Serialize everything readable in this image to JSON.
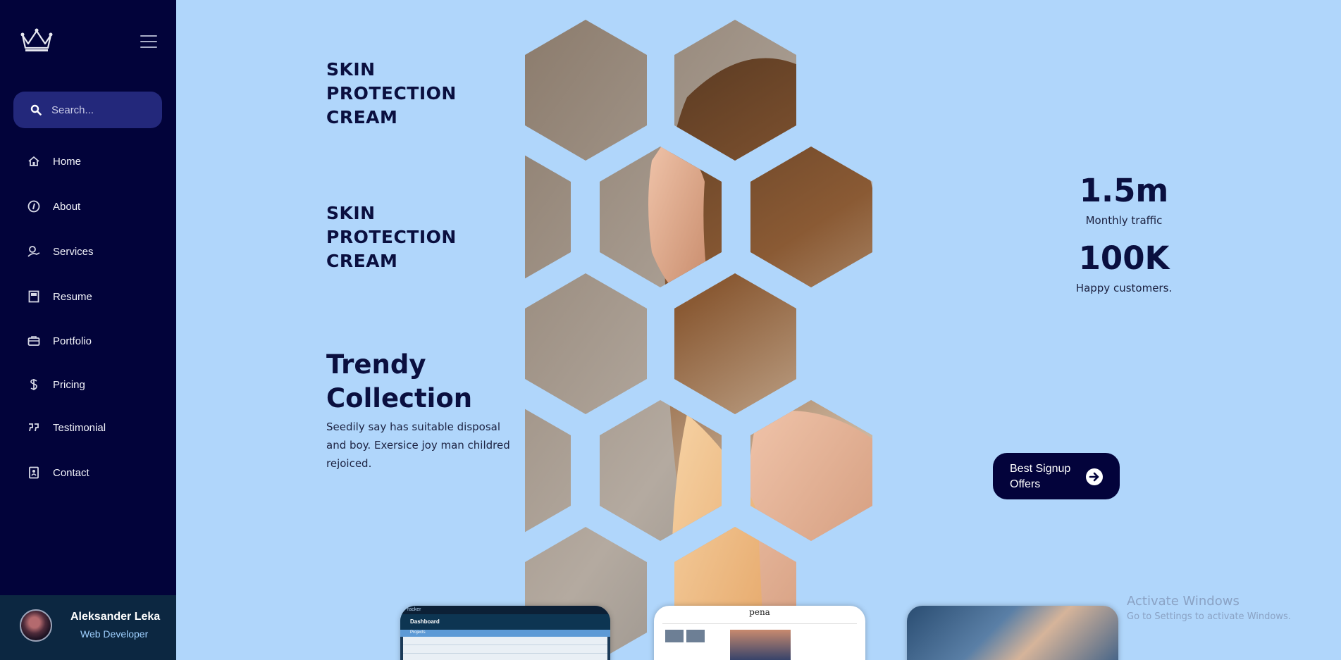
{
  "sidebar": {
    "search_placeholder": "Search...",
    "items": [
      {
        "label": "Home",
        "icon": "home-icon"
      },
      {
        "label": "About",
        "icon": "info-icon"
      },
      {
        "label": "Services",
        "icon": "services-icon"
      },
      {
        "label": "Resume",
        "icon": "resume-icon"
      },
      {
        "label": "Portfolio",
        "icon": "briefcase-icon"
      },
      {
        "label": "Pricing",
        "icon": "dollar-icon"
      },
      {
        "label": "Testimonial",
        "icon": "quote-icon"
      },
      {
        "label": "Contact",
        "icon": "contact-icon"
      }
    ],
    "profile": {
      "name": "Aleksander Leka",
      "role": "Web Developer"
    }
  },
  "main": {
    "heading1": "SKIN PROTECTION CREAM",
    "heading2": "SKIN PROTECTION CREAM",
    "trendy_title": "Trendy Collection",
    "description": "Seedily say has suitable disposal and boy. Exersice joy man childred rejoiced."
  },
  "stats": [
    {
      "value": "1.5m",
      "label": "Monthly traffic"
    },
    {
      "value": "100K",
      "label": "Happy customers."
    }
  ],
  "cta": {
    "label": "Best Signup Offers"
  },
  "cards": [
    {
      "app_label": "racker",
      "header": "Dashboard",
      "subheader": "Projects"
    },
    {
      "logo_text": "pena"
    },
    {}
  ],
  "watermark": {
    "line1": "Activate Windows",
    "line2": "Go to Settings to activate Windows."
  },
  "colors": {
    "sidebar_bg": "#02033a",
    "page_bg": "#b0d6fb",
    "accent": "#03033b",
    "search_bg": "#23287b",
    "profile_bg": "#0c2741"
  }
}
